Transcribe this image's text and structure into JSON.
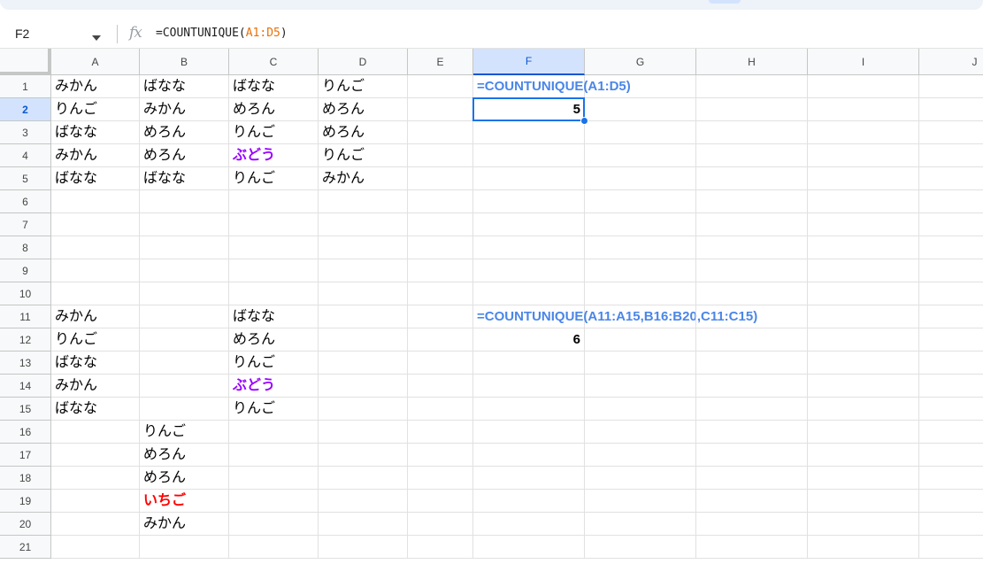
{
  "name_box": {
    "value": "F2"
  },
  "formula_bar": {
    "fx_label": "fx",
    "formula_prefix": "=COUNTUNIQUE(",
    "formula_ref": "A1:D5",
    "formula_suffix": ")"
  },
  "colors": {
    "formula_label": "#4a86e8",
    "purple": "#9900ff",
    "red": "#ff0000",
    "selection": "#1a73e8"
  },
  "columns": [
    "A",
    "B",
    "C",
    "D",
    "E",
    "F",
    "G",
    "H",
    "I",
    "J"
  ],
  "rows": [
    "1",
    "2",
    "3",
    "4",
    "5",
    "6",
    "7",
    "8",
    "9",
    "10",
    "11",
    "12",
    "13",
    "14",
    "15",
    "16",
    "17",
    "18",
    "19",
    "20",
    "21"
  ],
  "active_cell": {
    "col": "F",
    "row": "2"
  },
  "cells": [
    {
      "ref": "A1",
      "value": "みかん"
    },
    {
      "ref": "B1",
      "value": "ばなな"
    },
    {
      "ref": "C1",
      "value": "ばなな"
    },
    {
      "ref": "D1",
      "value": "りんご"
    },
    {
      "ref": "F1",
      "value": "=COUNTUNIQUE(A1:D5)",
      "style": "formula-label"
    },
    {
      "ref": "A2",
      "value": "りんご"
    },
    {
      "ref": "B2",
      "value": "みかん"
    },
    {
      "ref": "C2",
      "value": "めろん"
    },
    {
      "ref": "D2",
      "value": "めろん"
    },
    {
      "ref": "F2",
      "value": "5",
      "style": "result"
    },
    {
      "ref": "A3",
      "value": "ばなな"
    },
    {
      "ref": "B3",
      "value": "めろん"
    },
    {
      "ref": "C3",
      "value": "りんご"
    },
    {
      "ref": "D3",
      "value": "めろん"
    },
    {
      "ref": "A4",
      "value": "みかん"
    },
    {
      "ref": "B4",
      "value": "めろん"
    },
    {
      "ref": "C4",
      "value": "ぶどう",
      "style": "purple"
    },
    {
      "ref": "D4",
      "value": "りんご"
    },
    {
      "ref": "A5",
      "value": "ばなな"
    },
    {
      "ref": "B5",
      "value": "ばなな"
    },
    {
      "ref": "C5",
      "value": "りんご"
    },
    {
      "ref": "D5",
      "value": "みかん"
    },
    {
      "ref": "A11",
      "value": "みかん"
    },
    {
      "ref": "C11",
      "value": "ばなな"
    },
    {
      "ref": "F11",
      "value": "=COUNTUNIQUE(A11:A15,B16:B20,C11:C15)",
      "style": "formula-label"
    },
    {
      "ref": "A12",
      "value": "りんご"
    },
    {
      "ref": "C12",
      "value": "めろん"
    },
    {
      "ref": "F12",
      "value": "6",
      "style": "result"
    },
    {
      "ref": "A13",
      "value": "ばなな"
    },
    {
      "ref": "C13",
      "value": "りんご"
    },
    {
      "ref": "A14",
      "value": "みかん"
    },
    {
      "ref": "C14",
      "value": "ぶどう",
      "style": "purple"
    },
    {
      "ref": "A15",
      "value": "ばなな"
    },
    {
      "ref": "C15",
      "value": "りんご"
    },
    {
      "ref": "B16",
      "value": "りんご"
    },
    {
      "ref": "B17",
      "value": "めろん"
    },
    {
      "ref": "B18",
      "value": "めろん"
    },
    {
      "ref": "B19",
      "value": "いちご",
      "style": "red"
    },
    {
      "ref": "B20",
      "value": "みかん"
    }
  ]
}
